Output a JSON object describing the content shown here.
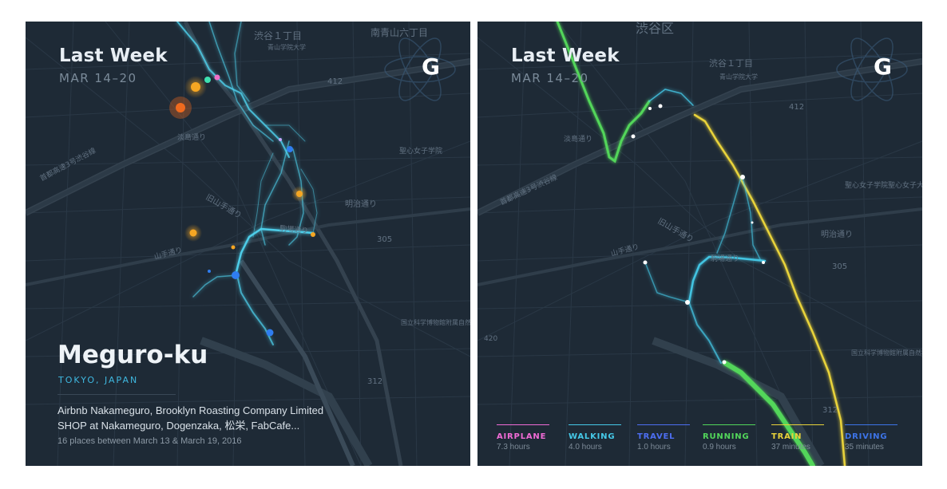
{
  "left_panel": {
    "title": "Last Week",
    "date_range": "MAR 14–20",
    "logo_letter": "G",
    "logo_icon": "atom-icon",
    "place_name": "Meguro-ku",
    "place_region": "TOKYO, JAPAN",
    "places_line1": "Airbnb Nakameguro, Brooklyn Roasting Company Limited",
    "places_line2": "SHOP at Nakameguro, Dogenzaka, 松栄, FabCafe...",
    "places_summary": "16 places between March 13 & March 19, 2016",
    "map_labels": {
      "shibuya1": "渋谷１丁目",
      "minami": "南青山六丁目",
      "aoyama": "青山学院大学",
      "route412": "412",
      "awashima": "淡島通り",
      "shuto": "首都高速3号渋谷線",
      "seishin": "聖心女子学院",
      "kyujo": "旧山手通り",
      "meiji": "明治通り",
      "yamate": "山手通り",
      "komaba": "駒場通り",
      "route305": "305",
      "science": "国立科学博物館附属自然教育園",
      "route312": "312"
    },
    "colors": {
      "walk": "#4fd2ee",
      "orange": "#f5a623",
      "dark_orange": "#f06a1e",
      "blue_dot": "#2f7df0",
      "pink_dot": "#f070c8",
      "teal_dot": "#3ee0b0"
    }
  },
  "right_panel": {
    "title": "Last Week",
    "date_range": "MAR 14–20",
    "logo_letter": "G",
    "logo_icon": "atom-icon",
    "map_labels": {
      "ward": "渋谷区",
      "shibuya1": "渋谷１丁目",
      "aoyama": "青山学院大学",
      "route412": "412",
      "awashima": "淡島通り",
      "shuto": "首都高速3号渋谷線",
      "seishin": "聖心女子学院聖心女子大学",
      "kyujo": "旧山手通り",
      "meiji": "明治通り",
      "yamate": "山手通り",
      "komaba": "駒場通り",
      "route305": "305",
      "science": "国立科学博物館附属自然教育園",
      "route312": "312",
      "route420": "420"
    },
    "legend": [
      {
        "label": "AIRPLANE",
        "value": "7.3 hours",
        "color": "#f06bd6"
      },
      {
        "label": "WALKING",
        "value": "4.0 hours",
        "color": "#45c9e8"
      },
      {
        "label": "TRAVEL",
        "value": "1.0 hours",
        "color": "#4d6ef2"
      },
      {
        "label": "RUNNING",
        "value": "0.9 hours",
        "color": "#52d65a"
      },
      {
        "label": "TRAIN",
        "value": "37 minutes",
        "color": "#e9d33a"
      },
      {
        "label": "DRIVING",
        "value": "35 minutes",
        "color": "#3d74e8"
      }
    ]
  }
}
